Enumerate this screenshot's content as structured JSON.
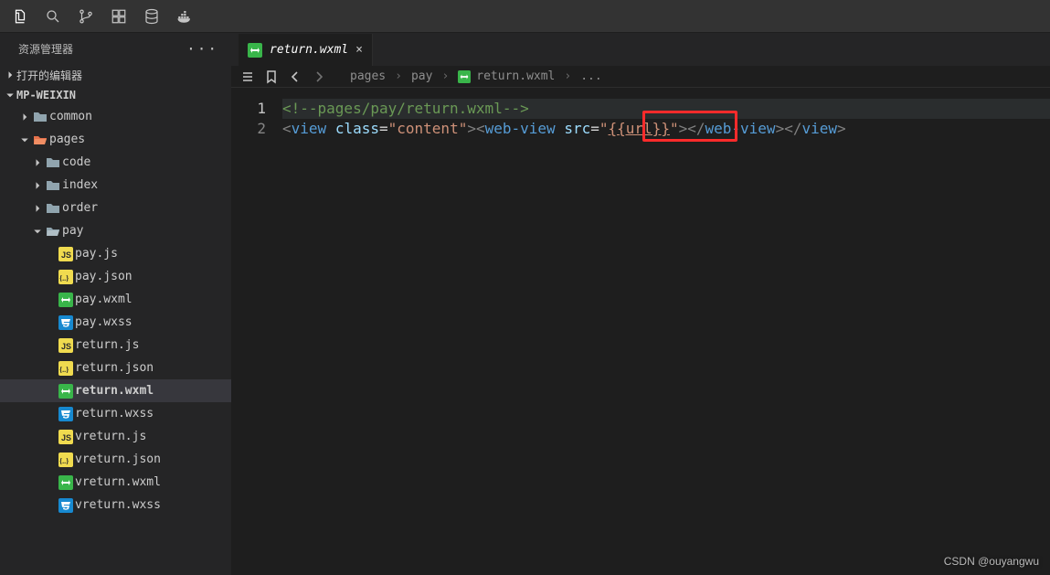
{
  "activity": {
    "buttons": [
      "files-icon",
      "search-icon",
      "source-control-icon",
      "extensions-icon",
      "db-icon",
      "docker-icon"
    ]
  },
  "sidebar": {
    "title": "资源管理器",
    "sections": {
      "openEditors": {
        "label": "打开的编辑器",
        "expanded": false
      },
      "project": {
        "label": "MP-WEIXIN",
        "expanded": true
      }
    },
    "tree": [
      {
        "indent": 1,
        "chev": "right",
        "icon": "folder",
        "label": "common"
      },
      {
        "indent": 1,
        "chev": "down",
        "icon": "folder-open-o",
        "label": "pages"
      },
      {
        "indent": 2,
        "chev": "right",
        "icon": "folder",
        "label": "code"
      },
      {
        "indent": 2,
        "chev": "right",
        "icon": "folder",
        "label": "index"
      },
      {
        "indent": 2,
        "chev": "right",
        "icon": "folder",
        "label": "order"
      },
      {
        "indent": 2,
        "chev": "down",
        "icon": "folder-open",
        "label": "pay"
      },
      {
        "indent": 3,
        "chev": "",
        "icon": "js",
        "label": "pay.js"
      },
      {
        "indent": 3,
        "chev": "",
        "icon": "json",
        "label": "pay.json"
      },
      {
        "indent": 3,
        "chev": "",
        "icon": "wxml",
        "label": "pay.wxml"
      },
      {
        "indent": 3,
        "chev": "",
        "icon": "wxss",
        "label": "pay.wxss"
      },
      {
        "indent": 3,
        "chev": "",
        "icon": "js",
        "label": "return.js"
      },
      {
        "indent": 3,
        "chev": "",
        "icon": "json",
        "label": "return.json"
      },
      {
        "indent": 3,
        "chev": "",
        "icon": "wxml",
        "label": "return.wxml",
        "active": true
      },
      {
        "indent": 3,
        "chev": "",
        "icon": "wxss",
        "label": "return.wxss"
      },
      {
        "indent": 3,
        "chev": "",
        "icon": "js",
        "label": "vreturn.js"
      },
      {
        "indent": 3,
        "chev": "",
        "icon": "json",
        "label": "vreturn.json"
      },
      {
        "indent": 3,
        "chev": "",
        "icon": "wxml",
        "label": "vreturn.wxml"
      },
      {
        "indent": 3,
        "chev": "",
        "icon": "wxss",
        "label": "vreturn.wxss"
      }
    ]
  },
  "tab": {
    "icon": "wxml",
    "label": "return.wxml",
    "close": "×"
  },
  "breadcrumbs": {
    "segments": [
      {
        "label": "pages"
      },
      {
        "label": "pay"
      },
      {
        "icon": "wxml",
        "label": "return.wxml"
      },
      {
        "label": "..."
      }
    ]
  },
  "code": {
    "lines": [
      "1",
      "2"
    ],
    "line1_comment": "<!--pages/pay/return.wxml-->",
    "line2": {
      "lt1": "<",
      "tag1": "view",
      "sp1": " ",
      "attr1": "class",
      "eq1": "=",
      "q1": "\"",
      "str1": "content",
      "q2": "\"",
      "gt1": ">",
      "lt2": "<",
      "tag2": "web-view",
      "sp2": " ",
      "attr2": "src",
      "eq2": "=",
      "q3": "\"",
      "str2": "{{url}}",
      "q4": "\"",
      "gt2": ">",
      "lt3": "</",
      "tag3": "web-view",
      "gt3": ">",
      "lt4": "</",
      "tag4": "view",
      "gt4": ">"
    }
  },
  "watermark": "CSDN @ouyangwu"
}
